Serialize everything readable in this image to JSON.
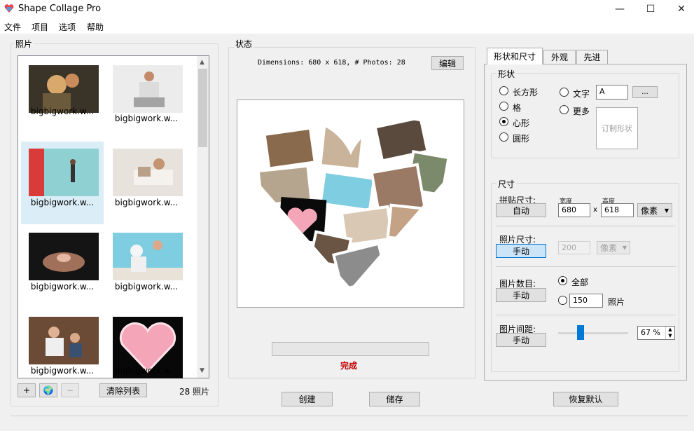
{
  "window": {
    "title": "Shape Collage Pro",
    "minimize": "—",
    "maximize": "☐",
    "close": "✕"
  },
  "menu": [
    "文件",
    "项目",
    "选项",
    "帮助"
  ],
  "photos_panel": {
    "label": "照片",
    "items": [
      {
        "name": "bigbigwork.w..."
      },
      {
        "name": "bigbigwork.w..."
      },
      {
        "name": "bigbigwork.w..."
      },
      {
        "name": "bigbigwork.w..."
      },
      {
        "name": "bigbigwork.w..."
      },
      {
        "name": "bigbigwork.w..."
      },
      {
        "name": "bigbigwork.w..."
      },
      {
        "name": "bigbigwork.w..."
      }
    ],
    "add": "+",
    "web": "🌍",
    "remove": "−",
    "clear": "清除列表",
    "count": "28 照片"
  },
  "status_panel": {
    "label": "状态",
    "dimensions": "Dimensions: 680 x 618, # Photos: 28",
    "edit": "编辑",
    "status_text": "完成",
    "progress": 0
  },
  "tabs": [
    "形状和尺寸",
    "外观",
    "先进"
  ],
  "shape": {
    "label": "形状",
    "options": [
      "长方形",
      "格",
      "心形",
      "圆形"
    ],
    "selected": "心形",
    "text_option": "文字",
    "more_option": "更多",
    "text_value": "A",
    "dots": "...",
    "custom": "订制形状"
  },
  "size": {
    "label": "尺寸",
    "collage_size_label": "拼贴尺寸:",
    "collage_size_button": "自动",
    "width_label": "宽度",
    "height_label": "高度",
    "width": "680",
    "x": "x",
    "height": "618",
    "unit": "像素",
    "photo_size_label": "照片尺寸:",
    "photo_size_button": "手动",
    "photo_size_value": "200",
    "photo_unit": "像素",
    "photo_count_label": "图片数目:",
    "photo_count_button": "手动",
    "all": "全部",
    "count_value": "150",
    "count_unit": "照片",
    "spacing_label": "图片间距:",
    "spacing_button": "手动",
    "spacing_value": "67 %",
    "spacing_level": 0.3
  },
  "bottom": {
    "create": "创建",
    "save": "储存",
    "restore": "恢复默认"
  },
  "colors": {
    "heart_pink": "#f4a6b8",
    "status_red": "#c00000",
    "accent": "#0078d7"
  }
}
